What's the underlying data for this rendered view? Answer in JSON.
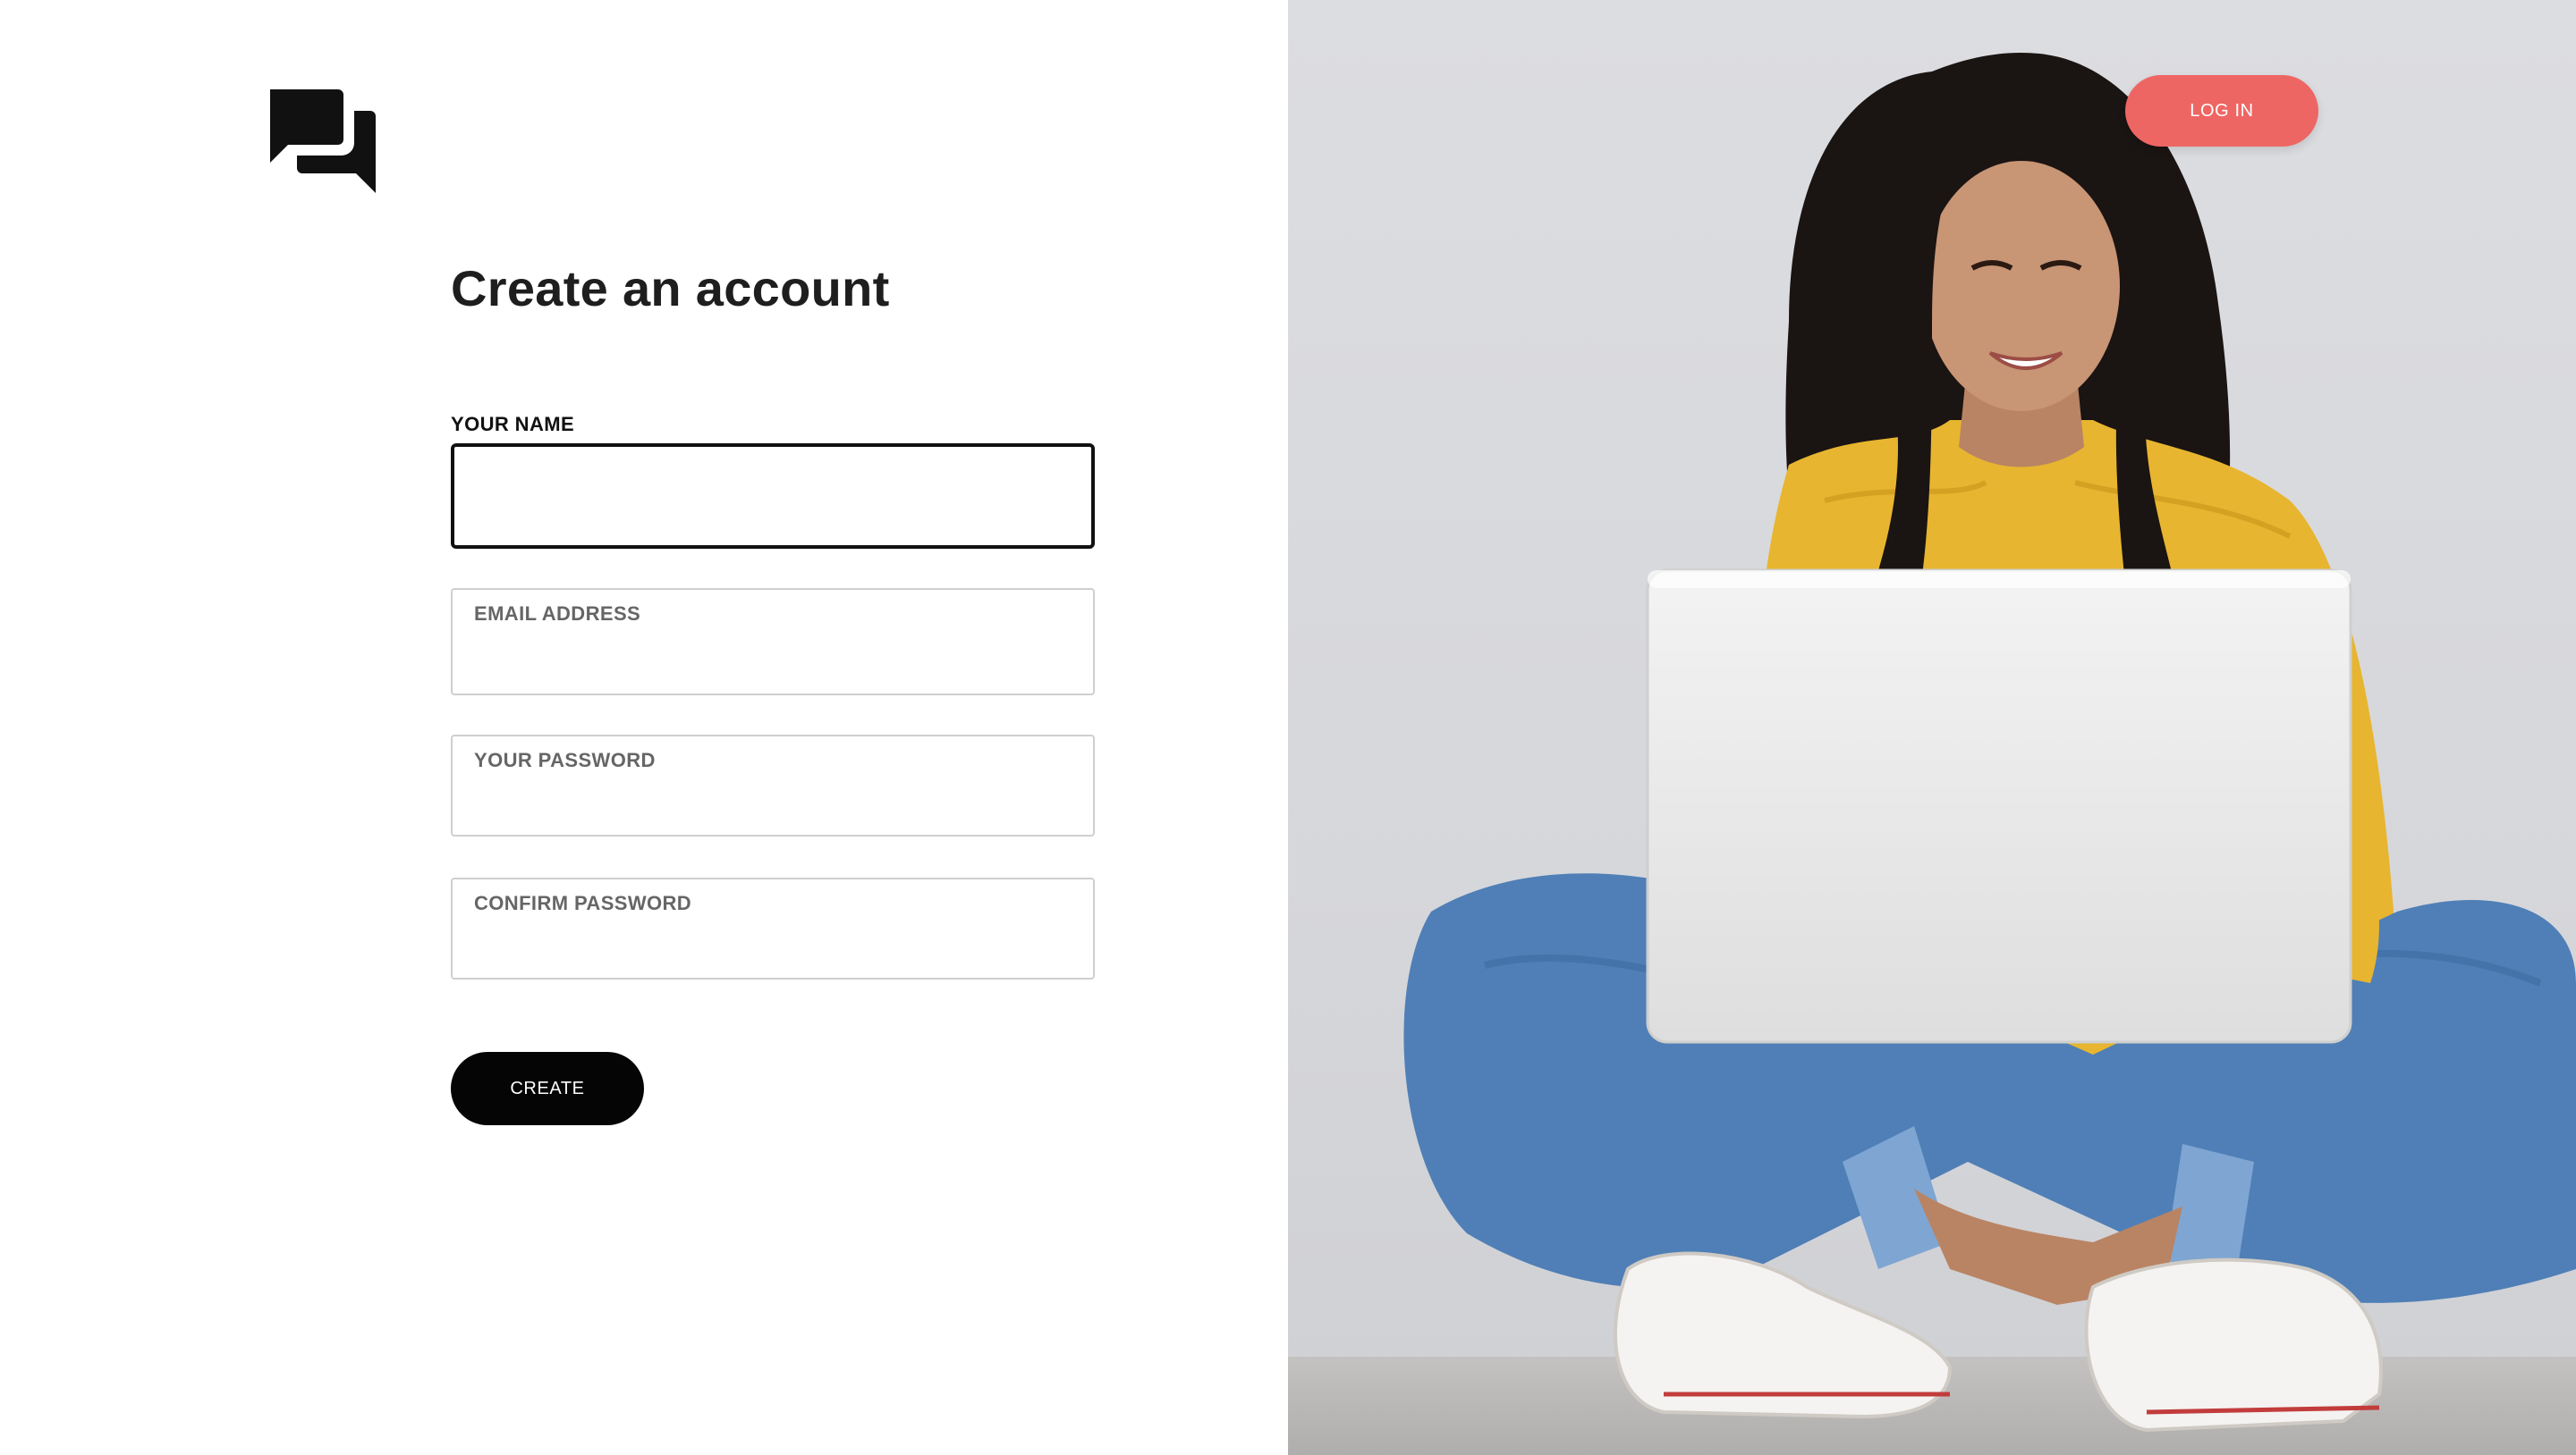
{
  "brand": {
    "logo_icon": "chat-bubbles-icon"
  },
  "page": {
    "title": "Create an account"
  },
  "form": {
    "name_label": "YOUR NAME",
    "name_value": "",
    "email_label": "EMAIL ADDRESS",
    "email_value": "",
    "password_label": "YOUR PASSWORD",
    "password_value": "",
    "confirm_label": "CONFIRM PASSWORD",
    "confirm_value": "",
    "submit_label": "CREATE"
  },
  "header": {
    "login_label": "LOG IN"
  },
  "colors": {
    "accent": "#ee6663",
    "primary_button": "#050505",
    "text": "#1e1e1e"
  },
  "hero_image": {
    "icon": "woman-with-laptop-photo"
  }
}
